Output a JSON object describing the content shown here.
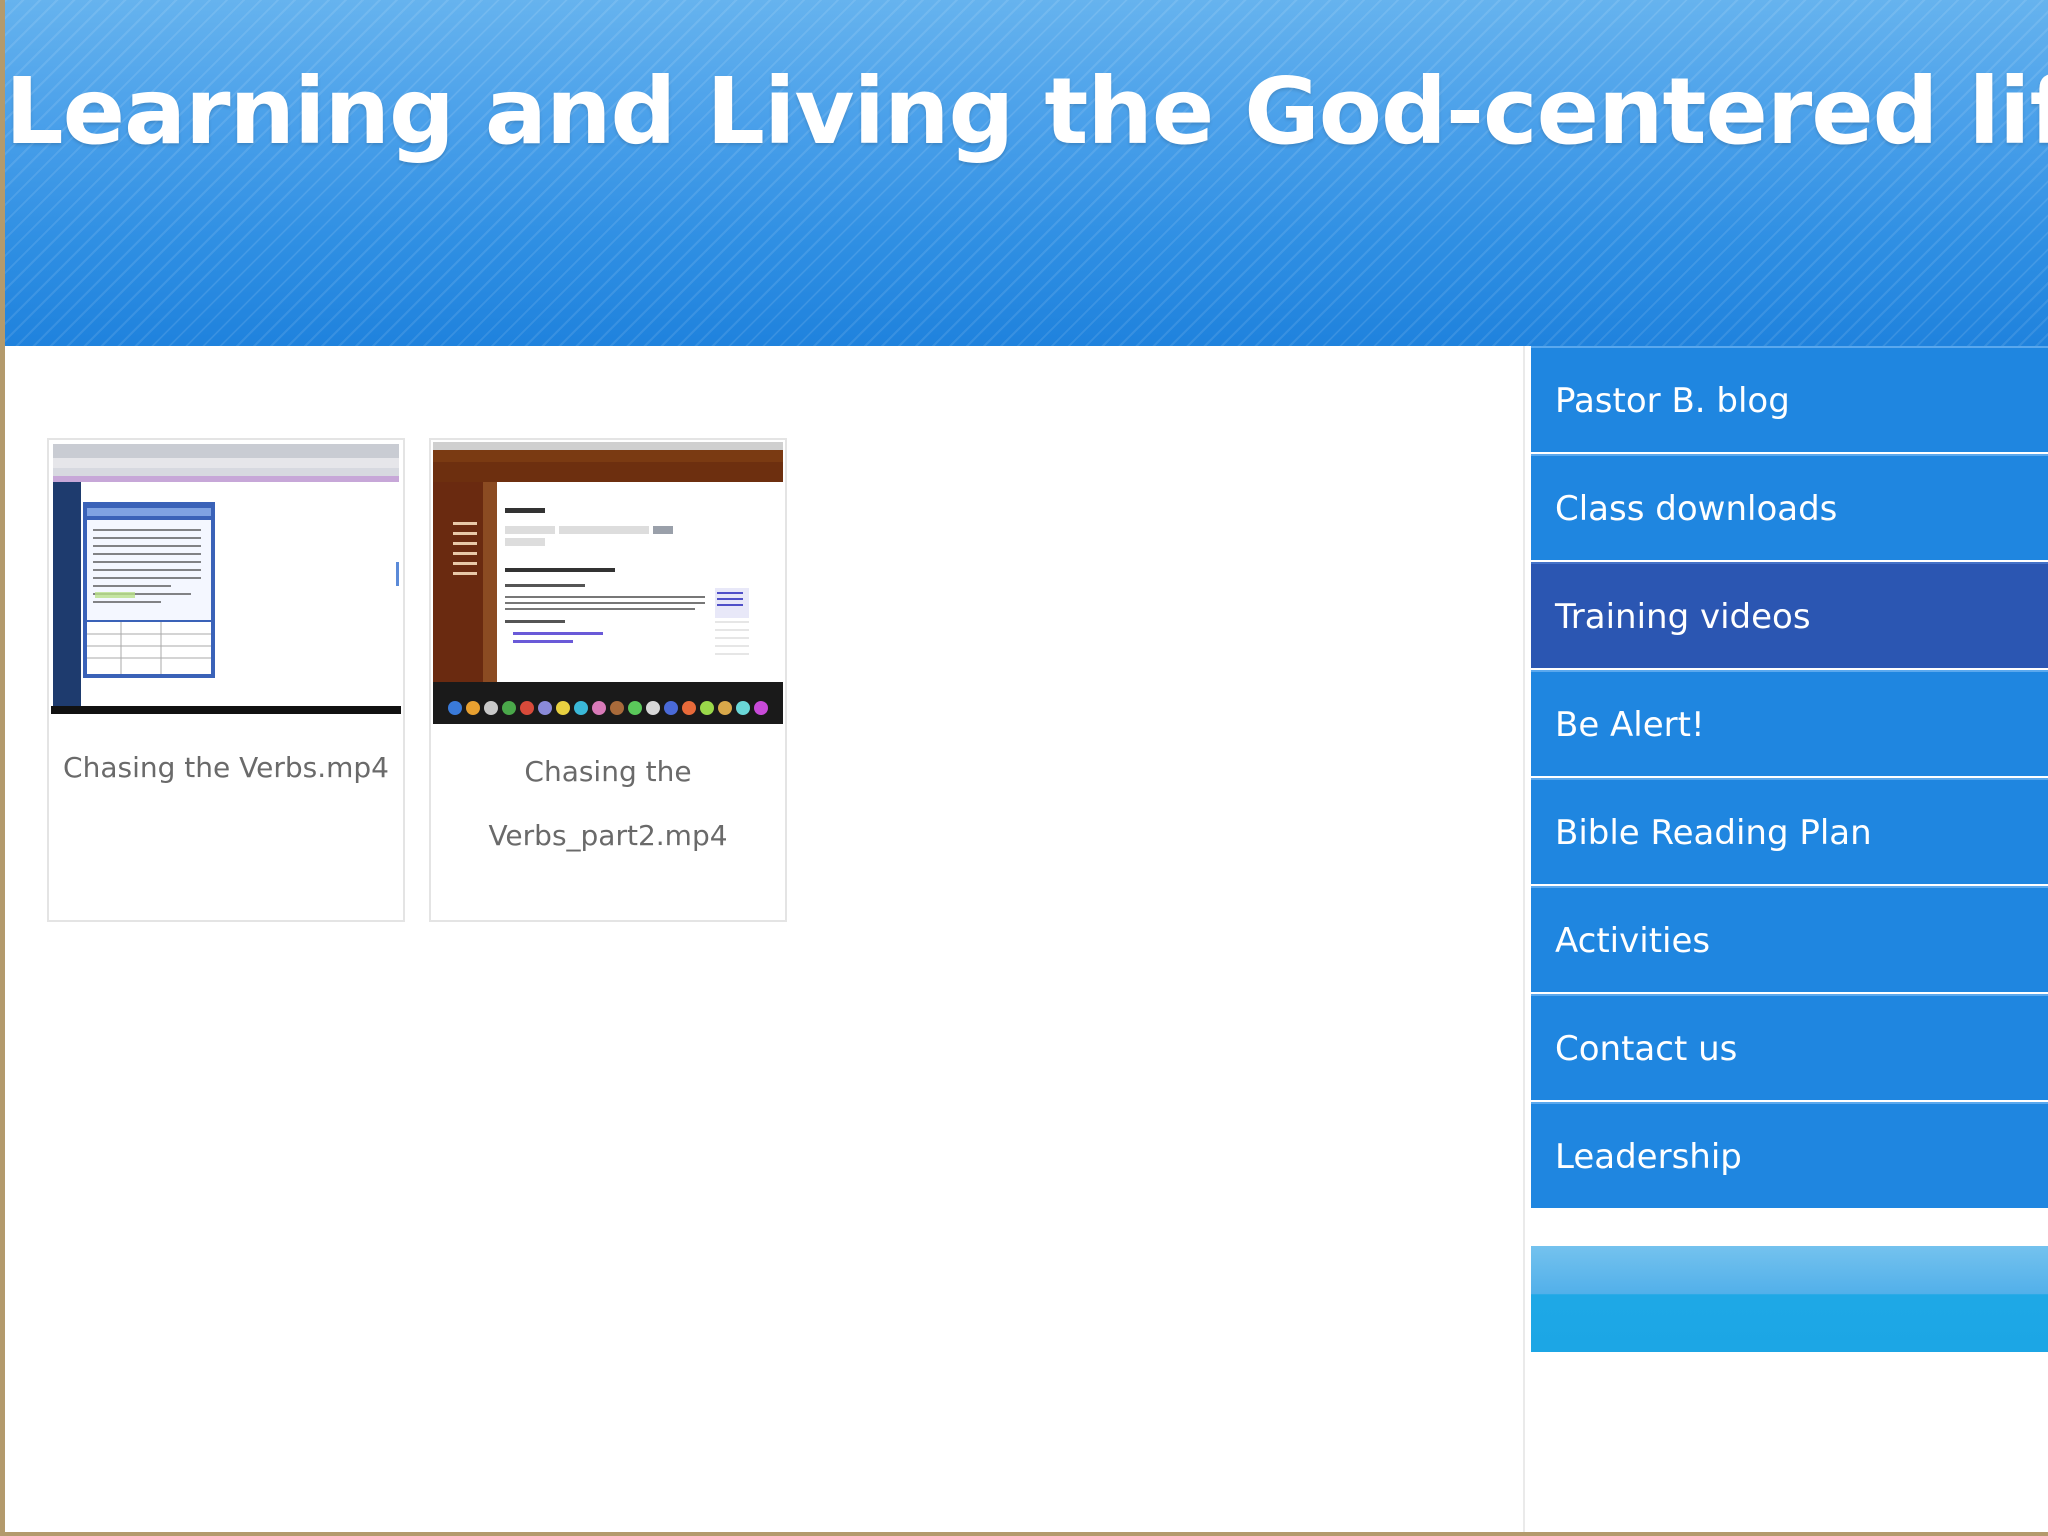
{
  "header": {
    "title": "Learning and Living the God-centered life"
  },
  "gallery": {
    "items": [
      {
        "caption": "Chasing the Verbs.mp4"
      },
      {
        "caption_line1": "Chasing the",
        "caption_line2": "Verbs_part2.mp4"
      }
    ]
  },
  "sidebar": {
    "items": [
      {
        "label": "Pastor B. blog"
      },
      {
        "label": "Class downloads"
      },
      {
        "label": "Training videos",
        "active": true
      },
      {
        "label": "Be Alert!"
      },
      {
        "label": "Bible Reading Plan"
      },
      {
        "label": "Activities"
      },
      {
        "label": "Contact us"
      },
      {
        "label": "Leadership"
      }
    ]
  },
  "colors": {
    "header": "#2f8fe3",
    "nav_item": "#1f86e0",
    "nav_active": "#2b56b2",
    "frame_border": "#b39a6c"
  }
}
